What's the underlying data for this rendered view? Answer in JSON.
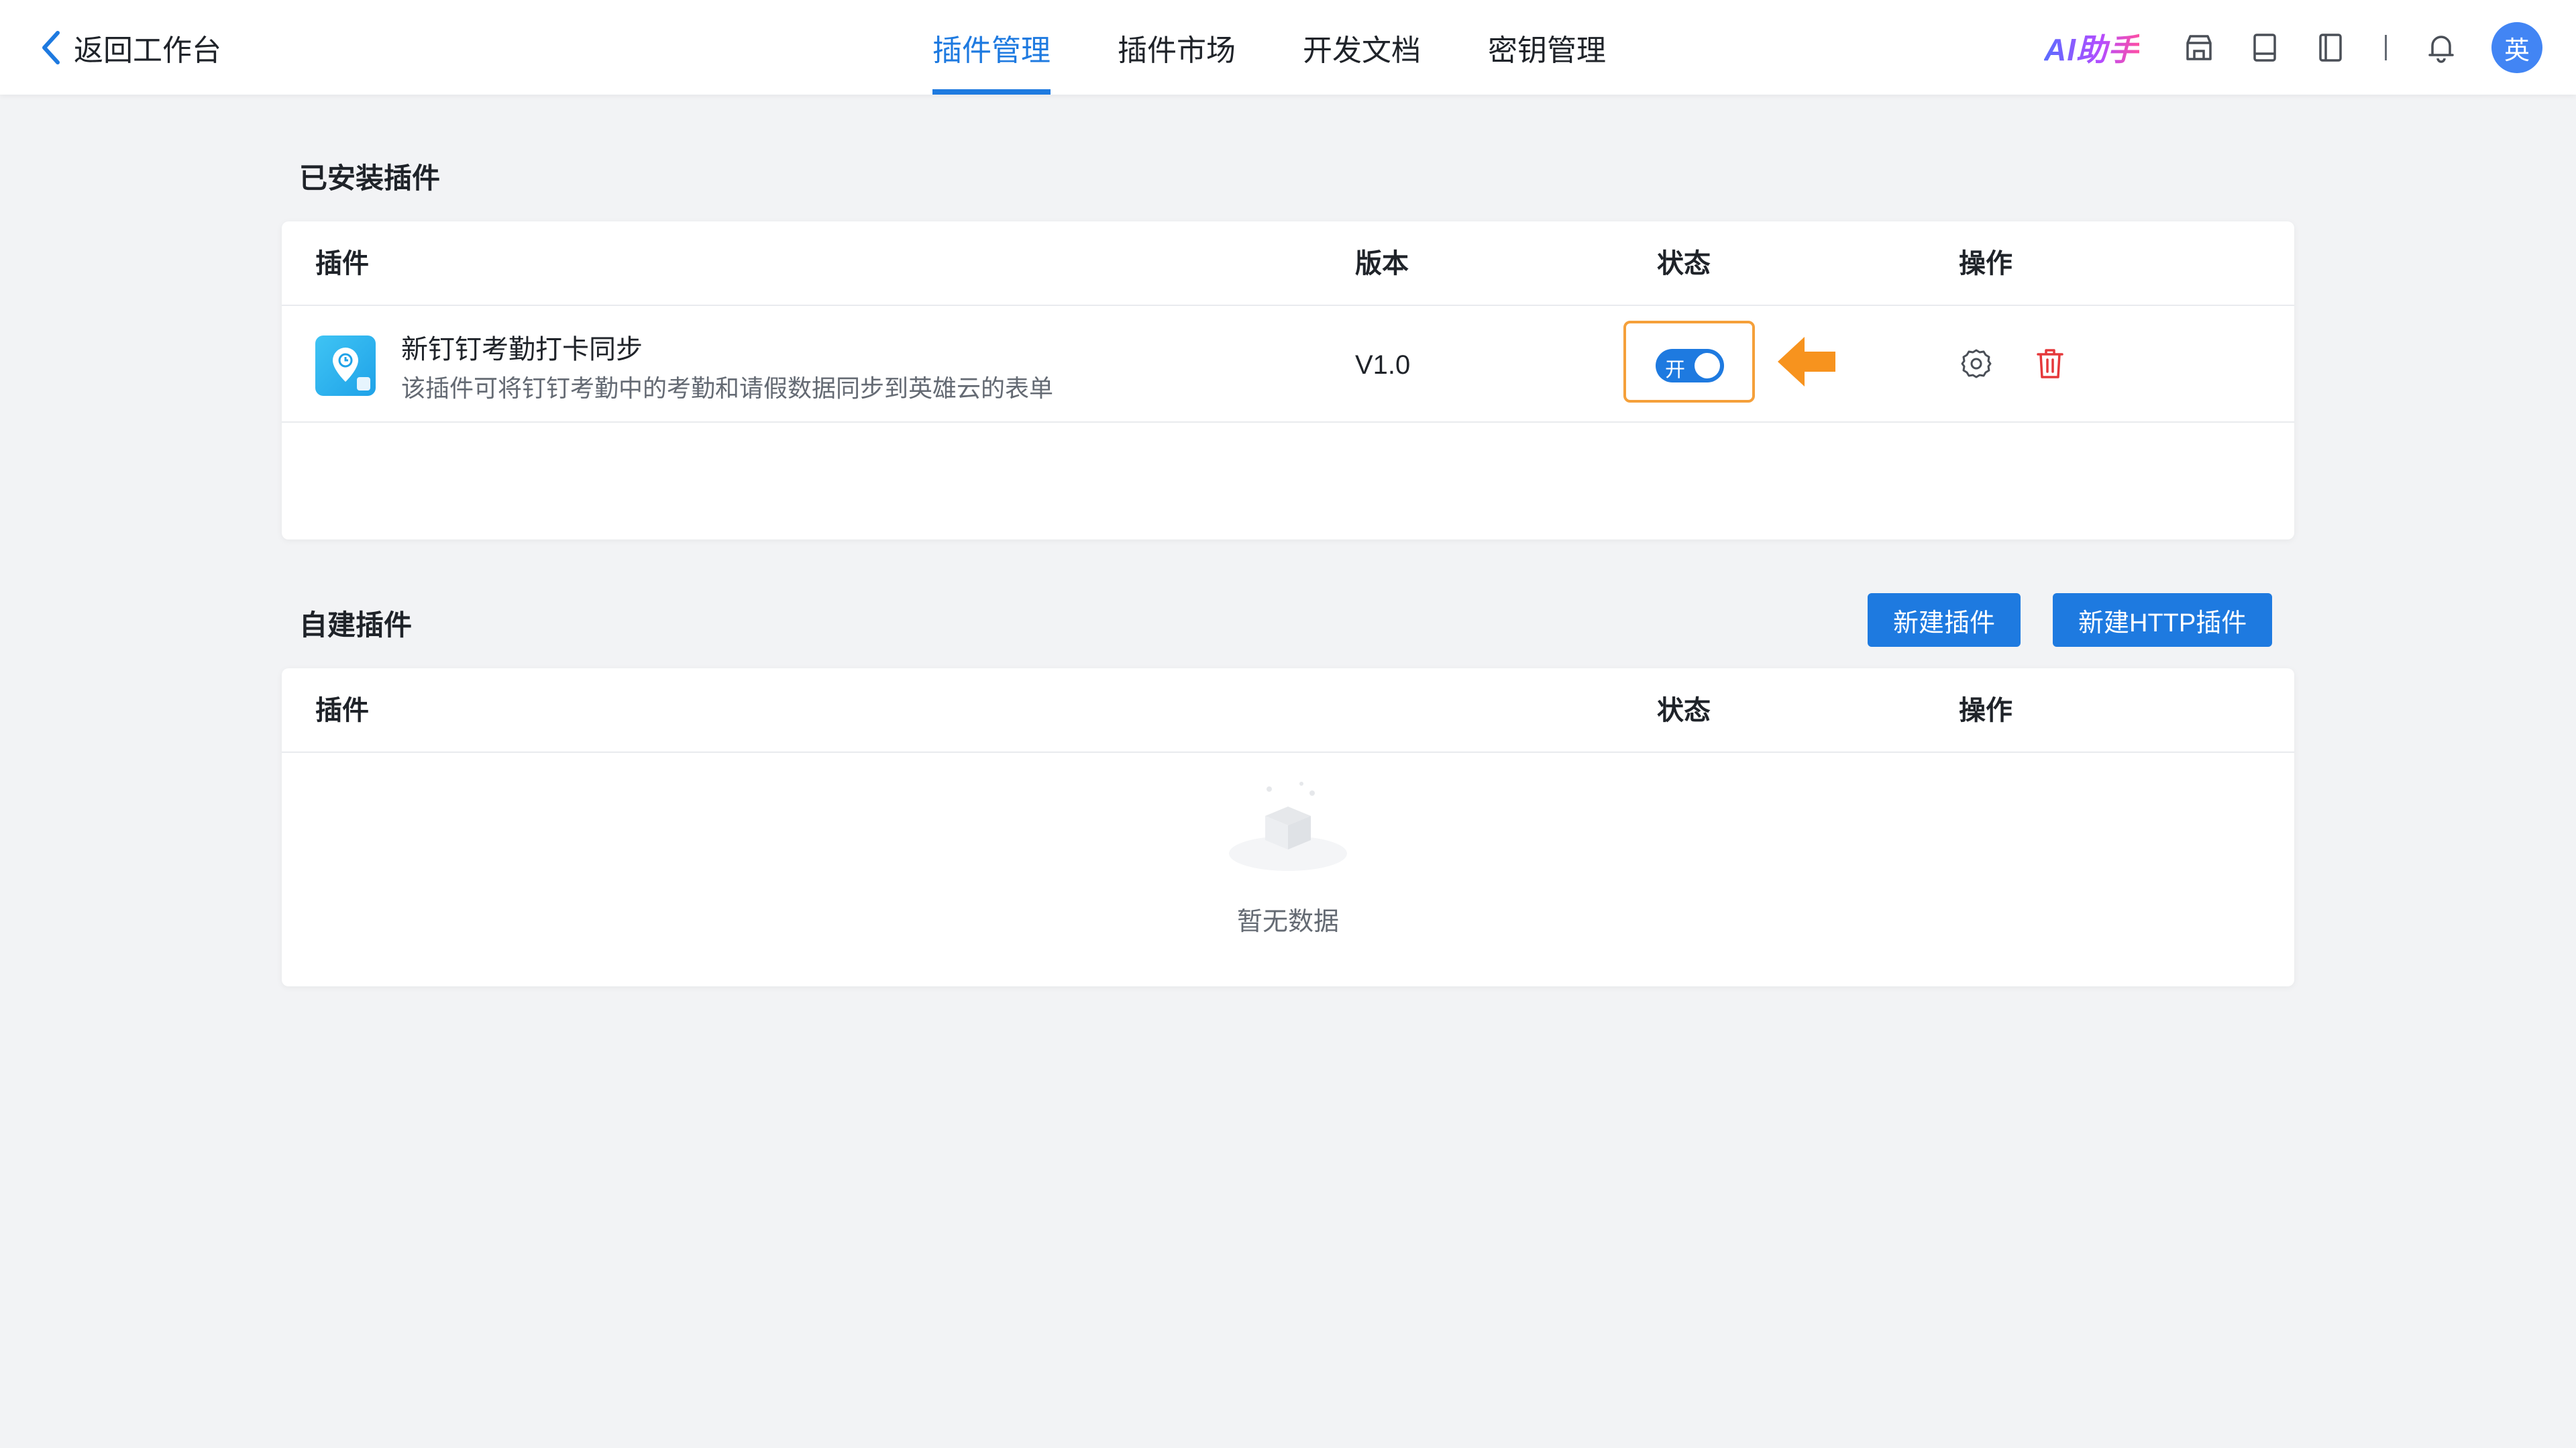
{
  "header": {
    "back_label": "返回工作台",
    "tabs": [
      {
        "label": "插件管理",
        "active": true
      },
      {
        "label": "插件市场",
        "active": false
      },
      {
        "label": "开发文档",
        "active": false
      },
      {
        "label": "密钥管理",
        "active": false
      }
    ],
    "ai_label": "AI助手",
    "avatar_text": "英",
    "tools": [
      "store-icon",
      "book-icon",
      "notebook-icon",
      "bell-icon"
    ]
  },
  "installed": {
    "title": "已安装插件",
    "columns": {
      "plugin": "插件",
      "version": "版本",
      "status": "状态",
      "actions": "操作"
    },
    "rows": [
      {
        "name": "新钉钉考勤打卡同步",
        "description": "该插件可将钉钉考勤中的考勤和请假数据同步到英雄云的表单",
        "version": "V1.0",
        "status_text": "开",
        "enabled": true
      }
    ]
  },
  "custom": {
    "title": "自建插件",
    "new_button": "新建插件",
    "new_http_button": "新建HTTP插件",
    "columns": {
      "plugin": "插件",
      "status": "状态",
      "actions": "操作"
    },
    "empty_text": "暂无数据"
  },
  "colors": {
    "accent": "#1e7ae0",
    "highlight": "#f5a03a",
    "danger": "#e5383b"
  }
}
